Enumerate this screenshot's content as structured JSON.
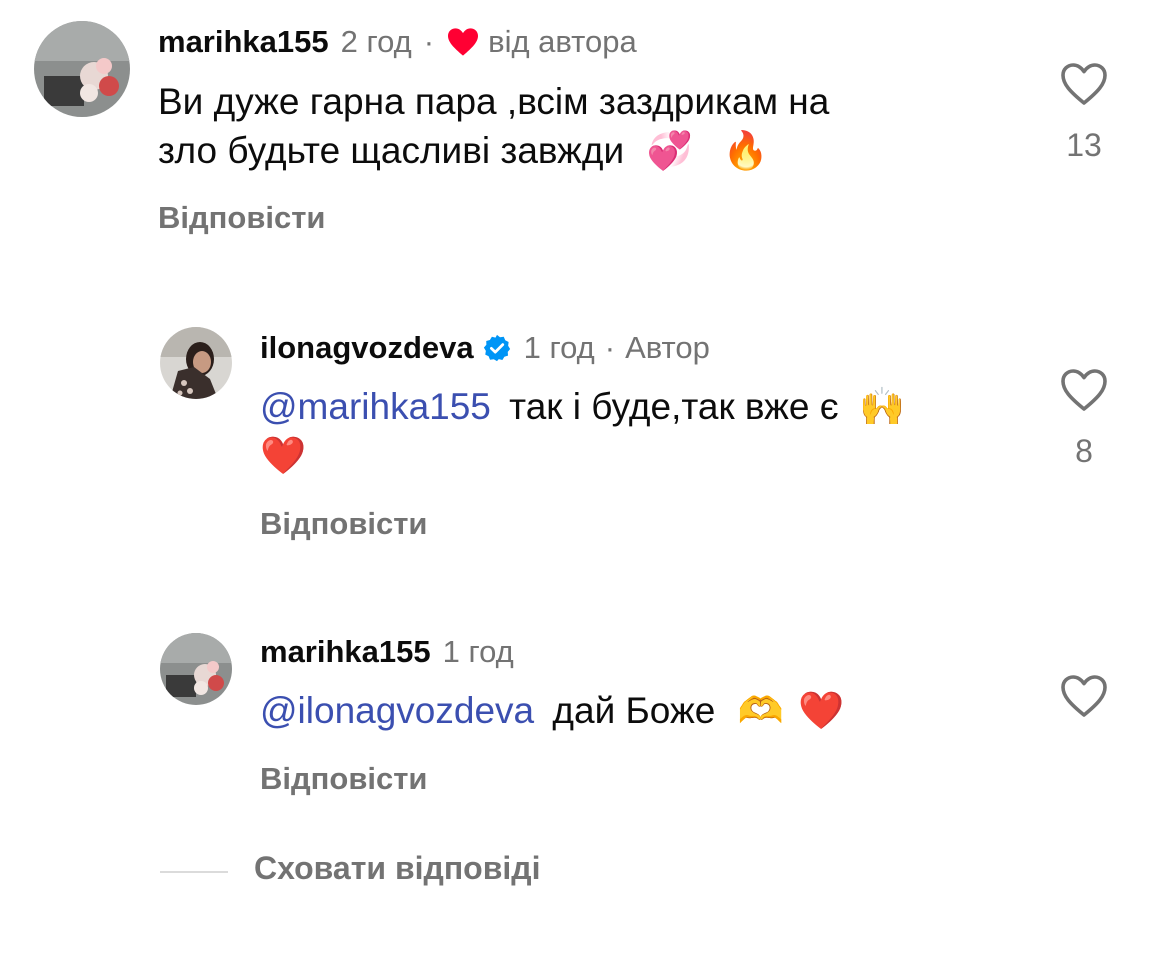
{
  "comments": [
    {
      "username": "marihka155",
      "time": "2 год",
      "sep": "·",
      "by_author_label": "від автора",
      "text_line1": "Ви дуже гарна пара ,всім заздрикам на",
      "text_line2": "зло будьте щасливі завжди",
      "emojis": [
        "💞",
        "🔥"
      ],
      "like_count": "13",
      "reply_label": "Відповісти"
    },
    {
      "username": "ilonagvozdeva",
      "time": "1 год",
      "sep": "·",
      "role_label": "Автор",
      "mention": "@marihka155",
      "text": "так і буде,так вже є",
      "emojis": [
        "🙌",
        "❤️"
      ],
      "like_count": "8",
      "reply_label": "Відповісти"
    },
    {
      "username": "marihka155",
      "time": "1 год",
      "mention": "@ilonagvozdeva",
      "text": "дай Боже",
      "emojis": [
        "🫶",
        "❤️"
      ],
      "reply_label": "Відповісти"
    }
  ],
  "hide_replies_label": "Сховати відповіді",
  "colors": {
    "text": "#0c0c0c",
    "secondary": "#737373",
    "mention": "#3b4fb0",
    "heart": "#ff0033",
    "verified": "#0095f6"
  },
  "icons": [
    "heart-outline-icon",
    "verified-badge-icon",
    "filled-heart-icon"
  ]
}
